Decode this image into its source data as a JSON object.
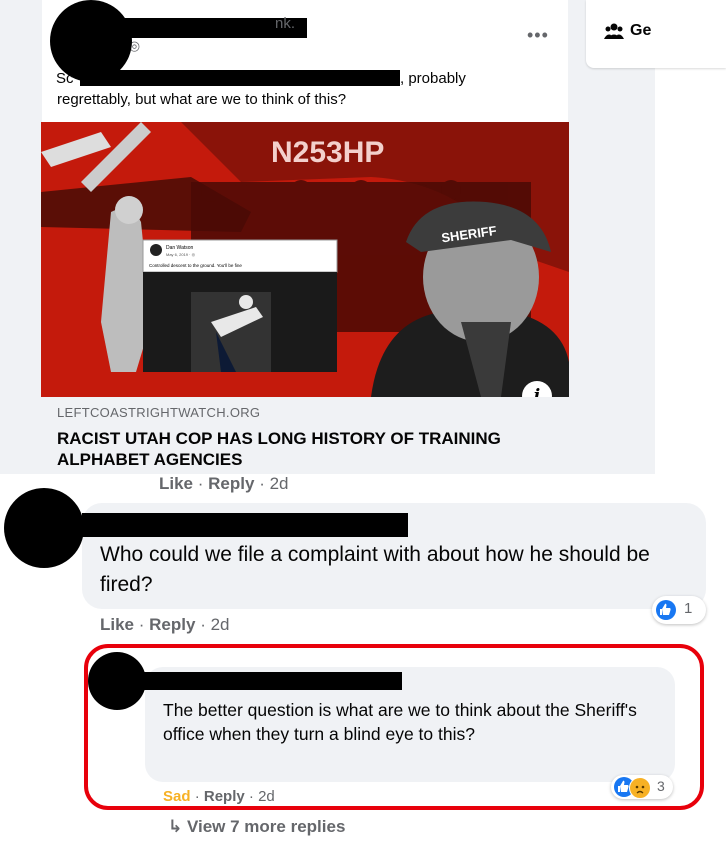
{
  "sidebar": {
    "group_label": "Ge"
  },
  "post": {
    "header_tail": "nk.",
    "time": "h · ◎",
    "more": "•••",
    "text_fragment": "Sc",
    "text_line1_tail": ", probably",
    "text_line2": "regrettably, but what are we to think of this?"
  },
  "link_preview": {
    "domain": "LEFTCOASTRIGHTWATCH.ORG",
    "title": "RACIST UTAH COP HAS LONG HISTORY OF TRAINING ALPHABET AGENCIES",
    "info": "i",
    "image": {
      "helicopter_tail": "N253HP",
      "cap_text": "SHERIFF",
      "embedded_post_author": "Dan Watson",
      "embedded_post_date": "May 6, 2019 · ◎",
      "embedded_post_text": "Controlled descent to the ground. You'll be fine"
    },
    "actions": {
      "like": "Like",
      "reply": "Reply",
      "time": "2d"
    }
  },
  "comment": {
    "text": "Who could we file a complaint with about how he should be fired?",
    "actions": {
      "like": "Like",
      "reply": "Reply",
      "time": "2d"
    },
    "reaction_count": "1"
  },
  "reply": {
    "text": "The better question is what are we to think about the Sheriff's office when they turn a blind eye to this?",
    "actions": {
      "reaction": "Sad",
      "reply": "Reply",
      "time": "2d"
    },
    "reaction_count": "3"
  },
  "view_more": "↳ View 7 more replies",
  "colors": {
    "fb_blue": "#1877f2",
    "highlight": "#e8000b",
    "sad_yellow": "#f7b125",
    "bubble": "#f0f2f5"
  }
}
